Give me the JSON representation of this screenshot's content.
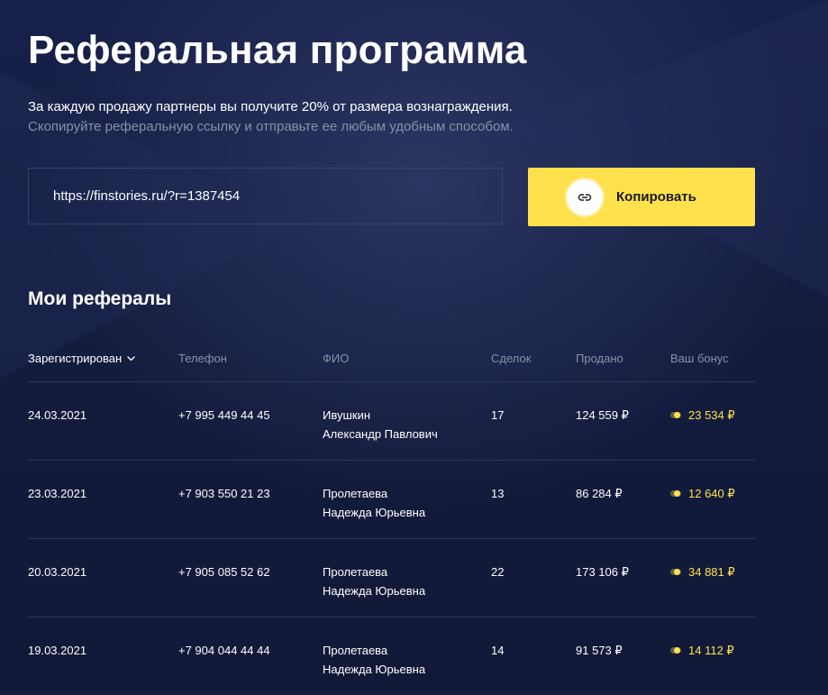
{
  "page": {
    "title": "Реферальная программа",
    "intro": "За каждую продажу партнеры вы получите 20% от размера вознаграждения.",
    "hint": "Скопируйте реферальную ссылку и отправьте ее любым удобным способом."
  },
  "referral": {
    "link_value": "https://finstories.ru/?r=1387454",
    "copy_label": "Копировать",
    "copy_icon": "link-icon"
  },
  "referrals": {
    "title": "Мои рефералы",
    "columns": {
      "registered": "Зарегистрирован",
      "phone": "Телефон",
      "fio": "ФИО",
      "deals": "Сделок",
      "sold": "Продано",
      "bonus": "Ваш бонус"
    },
    "sort_icon": "chevron-down-icon",
    "bonus_icon": "coin-icon",
    "rows": [
      {
        "date": "24.03.2021",
        "phone": "+7 995 449 44 45",
        "last_name": "Ивушкин",
        "first_names": "Александр Павлович",
        "deals": "17",
        "sold": "124 559 ₽",
        "bonus": "23 534 ₽"
      },
      {
        "date": "23.03.2021",
        "phone": "+7 903 550 21 23",
        "last_name": "Пролетаева",
        "first_names": "Надежда Юрьевна",
        "deals": "13",
        "sold": "86 284 ₽",
        "bonus": "12 640 ₽"
      },
      {
        "date": "20.03.2021",
        "phone": "+7 905 085 52 62",
        "last_name": "Пролетаева",
        "first_names": "Надежда Юрьевна",
        "deals": "22",
        "sold": "173 106 ₽",
        "bonus": "34 881 ₽"
      },
      {
        "date": "19.03.2021",
        "phone": "+7 904 044 44 44",
        "last_name": "Пролетаева",
        "first_names": "Надежда Юрьевна",
        "deals": "14",
        "sold": "91 573 ₽",
        "bonus": "14 112 ₽"
      }
    ]
  },
  "colors": {
    "background": "#141c3f",
    "accent": "#ffe14d",
    "muted_text": "#8a90aa",
    "divider": "#2f3657"
  }
}
